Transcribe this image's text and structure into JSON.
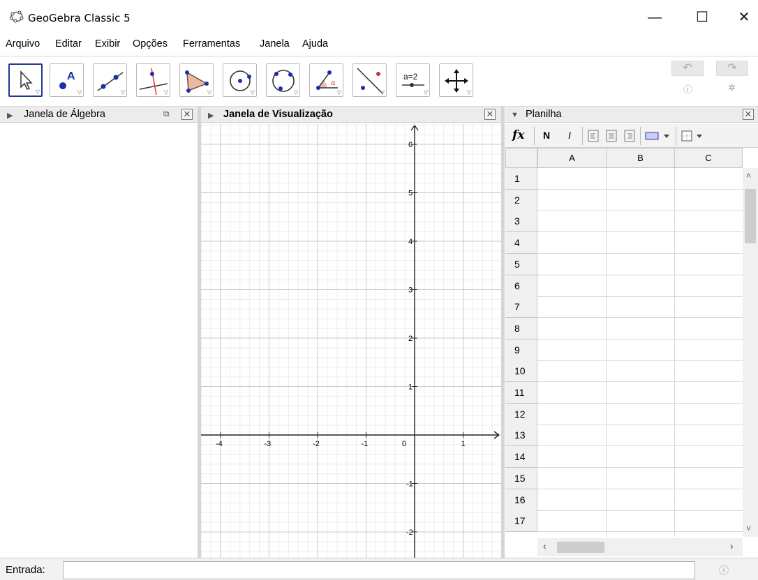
{
  "window": {
    "title": "GeoGebra Classic 5",
    "minimize": "—",
    "maximize": "☐",
    "close": "✕"
  },
  "menu": [
    "Arquivo",
    "Editar",
    "Exibir",
    "Opções",
    "Ferramentas",
    "Janela",
    "Ajuda"
  ],
  "toolbar": {
    "tools": [
      "move-tool",
      "point-tool",
      "line-tool",
      "perpendicular-tool",
      "polygon-tool",
      "circle-center-tool",
      "circle-3points-tool",
      "angle-tool",
      "reflect-tool",
      "slider-tool",
      "move-graphics-tool"
    ],
    "slider_label": "a=2",
    "point_label": "A",
    "angle_label": "α",
    "undo_icon": "undo-icon",
    "redo_icon": "redo-icon"
  },
  "algebra": {
    "title": "Janela de Álgebra"
  },
  "graphics": {
    "title": "Janela de Visualização",
    "x_ticks": [
      "-4",
      "-3",
      "-2",
      "-1",
      "0",
      "1"
    ],
    "y_ticks": [
      "6",
      "5",
      "4",
      "3",
      "2",
      "1",
      "-1",
      "-2"
    ]
  },
  "spreadsheet": {
    "title": "Planilha",
    "fx": "fx",
    "bold": "N",
    "italic": "I",
    "columns": [
      "A",
      "B",
      "C"
    ],
    "rows": [
      "1",
      "2",
      "3",
      "4",
      "5",
      "6",
      "7",
      "8",
      "9",
      "10",
      "11",
      "12",
      "13",
      "14",
      "15",
      "16",
      "17"
    ]
  },
  "input": {
    "label": "Entrada:",
    "value": ""
  }
}
